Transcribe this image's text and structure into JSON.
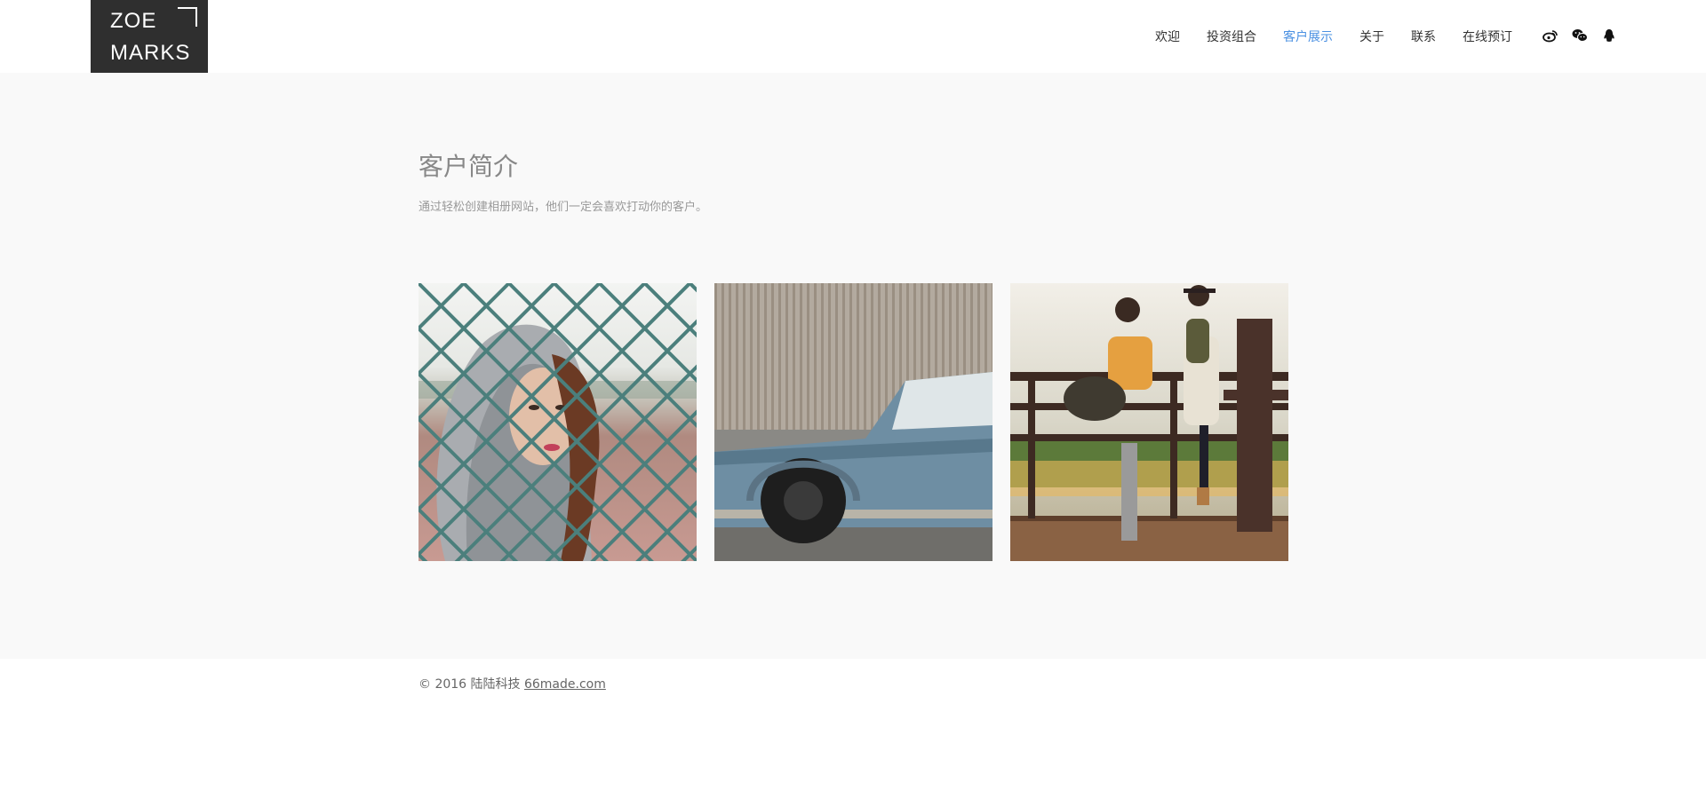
{
  "logo": {
    "line1": "ZOE",
    "line2": "MARKS"
  },
  "nav": {
    "items": [
      {
        "label": "欢迎",
        "active": false
      },
      {
        "label": "投资组合",
        "active": false
      },
      {
        "label": "客户展示",
        "active": true
      },
      {
        "label": "关于",
        "active": false
      },
      {
        "label": "联系",
        "active": false
      },
      {
        "label": "在线预订",
        "active": false
      }
    ],
    "social": [
      "weibo-icon",
      "wechat-icon",
      "qq-icon"
    ],
    "active_color": "#4a90e2"
  },
  "section": {
    "title": "客户简介",
    "description": "通过轻松创建相册网站，他们一定会喜欢打动你的客户。"
  },
  "gallery": {
    "photos": [
      "woman-behind-fence-photo",
      "vintage-car-photo",
      "backpackers-photo"
    ]
  },
  "footer": {
    "copyright": "© 2016 陆陆科技",
    "link": "66made.com"
  }
}
